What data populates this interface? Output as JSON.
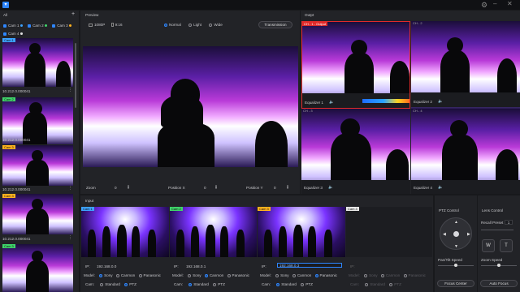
{
  "app": {
    "brand_icon": "app-logo-icon",
    "settings_icon": "gear-icon"
  },
  "sidebar": {
    "title": "All",
    "filters": [
      {
        "label": "Cam 1",
        "dot": "#3da2ff"
      },
      {
        "label": "Cam 2",
        "dot": "#3fd46a"
      },
      {
        "label": "Cam 3",
        "dot": "#ffb21e"
      },
      {
        "label": "Cam 4",
        "dot": "#e0e0e0"
      }
    ],
    "thumbs": [
      {
        "tag": "Cam 1",
        "tag_color": "#3da2ff",
        "ip": "10.212.0.000041"
      },
      {
        "tag": "Cam 2",
        "tag_color": "#3fd46a",
        "ip": "10.212.0.000041"
      },
      {
        "tag": "Cam 3",
        "tag_color": "#ffb21e",
        "ip": "10.212.0.000041"
      },
      {
        "tag": "Cam 3",
        "tag_color": "#ffb21e",
        "ip": "10.212.0.000041"
      },
      {
        "tag": "Cam 3",
        "tag_color": "#3fd46a",
        "ip": ""
      }
    ]
  },
  "preview": {
    "title": "Preview",
    "chk1": "1080P",
    "chk2": "9:16",
    "modes": [
      "Normal",
      "Light",
      "Wide"
    ],
    "transmission": "Transmission",
    "zoom_label": "Zoom",
    "zoom_val": "0",
    "pos_x_label": "Position X",
    "pos_x_val": "0",
    "pos_y_label": "Position Y",
    "pos_y_val": "0"
  },
  "output": {
    "title": "Outpt",
    "cells": [
      {
        "tag": "CH - 1 - Output",
        "label": "Equalizer 1",
        "active": true
      },
      {
        "tag": "CH - 2",
        "label": "Equalizer 2",
        "active": false
      },
      {
        "tag": "CH - 3",
        "label": "Equalizer 3",
        "active": false
      },
      {
        "tag": "CH - 4",
        "label": "Equalizer 4",
        "active": false
      }
    ]
  },
  "input": {
    "title": "Input",
    "cams": [
      {
        "tag": "Cam 1",
        "tag_color": "#3da2ff",
        "ip": "192.168.0.0",
        "model": "Sony",
        "cam": "PTZ",
        "editing": false
      },
      {
        "tag": "Cam 2",
        "tag_color": "#3fd46a",
        "ip": "192.168.0.1",
        "model": "Canmon",
        "cam": "Standard",
        "editing": false
      },
      {
        "tag": "Cam 3",
        "tag_color": "#ffb21e",
        "ip": "192.168.0.3",
        "model": "Panasonic",
        "cam": "Standard",
        "editing": true
      },
      {
        "tag": "Cam 4",
        "tag_color": "#e8e8e8",
        "ip": "",
        "model": "",
        "cam": "",
        "editing": false
      }
    ],
    "ip_label": "IP:",
    "model_label": "Model:",
    "cam_label": "Cam:",
    "model_opts": [
      "Sony",
      "Canmon",
      "Panasonic"
    ],
    "cam_opts": [
      "Standard",
      "PTZ"
    ]
  },
  "ptz": {
    "title": "PTZ Control",
    "pan_tilt_label": "Pan/Tilt Speed",
    "focus_center": "Focus Center"
  },
  "lens": {
    "title": "Lens Control",
    "recall_label": "Recall Preset 1",
    "recall_val": "1",
    "zoom_speed_label": "Zoom Speed",
    "w_label": "W",
    "t_label": "T",
    "auto_focus": "Auto Focus"
  }
}
